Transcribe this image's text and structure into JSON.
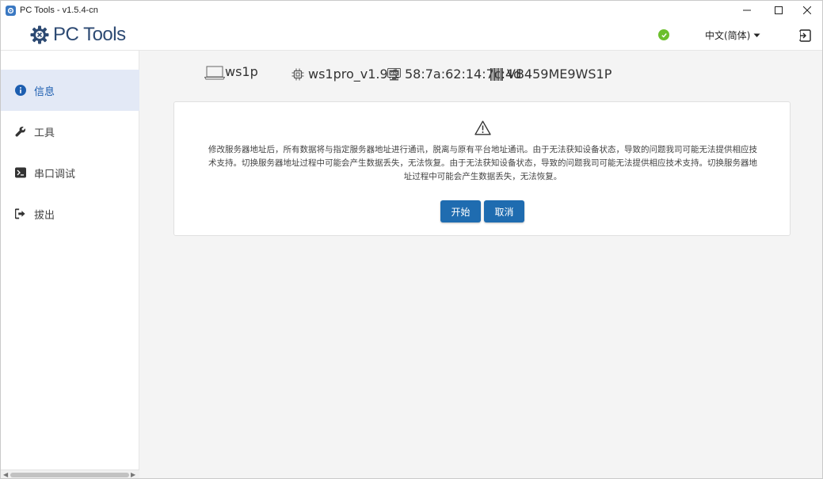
{
  "window": {
    "title": "PC Tools - v1.5.4-cn",
    "controls": [
      "minimize-icon",
      "maximize-icon",
      "close-icon"
    ]
  },
  "header": {
    "logo_text": "PC Tools",
    "status": "connected",
    "status_color": "#6cbf2d",
    "language": "中文(简体)",
    "logout_icon": "logout-icon"
  },
  "sidebar": {
    "items": [
      {
        "label": "信息",
        "icon": "info-icon",
        "active": true
      },
      {
        "label": "工具",
        "icon": "wrench-icon",
        "active": false
      },
      {
        "label": "串口调试",
        "icon": "terminal-icon",
        "active": false
      },
      {
        "label": "拔出",
        "icon": "eject-icon",
        "active": false
      }
    ]
  },
  "device_info": {
    "name": "ws1p",
    "firmware": "ws1pro_v1.9.1",
    "mac": "58:7a:62:14:7c:4d",
    "mac_badge": "MAC",
    "serial": "VB459ME9WS1P"
  },
  "dialog": {
    "message": "修改服务器地址后，所有数据将与指定服务器地址进行通讯，脱离与原有平台地址通讯。由于无法获知设备状态，导致的问题我司可能无法提供相应技术支持。切换服务器地址过程中可能会产生数据丢失，无法恢复。由于无法获知设备状态，导致的问题我司可能无法提供相应技术支持。切换服务器地址过程中可能会产生数据丢失，无法恢复。",
    "start_label": "开始",
    "cancel_label": "取消"
  },
  "colors": {
    "accent": "#1f6cb0",
    "active_nav_bg": "#e3e9f6",
    "logo": "#2d4a73"
  }
}
